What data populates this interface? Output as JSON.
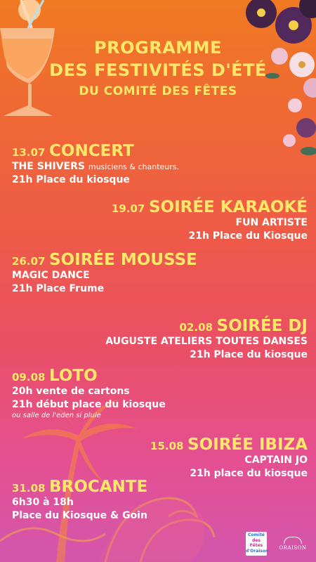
{
  "title": {
    "line1": "PROGRAMME",
    "line2": "DES FESTIVITÉS D'ÉTÉ",
    "line3": "DU COMITÉ DES FÊTES"
  },
  "events": [
    {
      "date": "13.07",
      "name": "CONCERT",
      "line1": "THE SHIVERS",
      "line1_small": "musiciens & chanteurs.",
      "line2": "21h Place du kiosque"
    },
    {
      "date": "19.07",
      "name": "SOIRÉE KARAOKÉ",
      "line1": "FUN ARTISTE",
      "line2": "21h Place du Kiosque"
    },
    {
      "date": "26.07",
      "name": "SOIRÉE MOUSSE",
      "line1": "MAGIC DANCE",
      "line2": "21h Place Frume"
    },
    {
      "date": "02.08",
      "name": "SOIRÉE DJ",
      "line1": "AUGUSTE ATELIERS TOUTES DANSES",
      "line2": "21h Place du kiosque"
    },
    {
      "date": "09.08",
      "name": "LOTO",
      "line1": "20h vente de cartons",
      "line2": "21h début place du kiosque",
      "note": "ou salle de l'eden si pluie"
    },
    {
      "date": "15.08",
      "name": "SOIRÉE IBIZA",
      "line1": "CAPTAIN JO",
      "line2": "21h place du kiosque"
    },
    {
      "date": "31.08",
      "name": "BROCANTE",
      "line1": "6h30 à 18h",
      "line2": "Place du Kiosque & Goin"
    }
  ],
  "logos": {
    "comite": {
      "l1": "Comité",
      "l2": "des Fêtes",
      "l3": "d'Oraison"
    },
    "oraison": "ORAISON"
  },
  "colors": {
    "title_yellow": "#ffe76a",
    "text_white": "#ffffff",
    "bg_top": "#f07a22",
    "bg_bottom": "#d356ad"
  }
}
